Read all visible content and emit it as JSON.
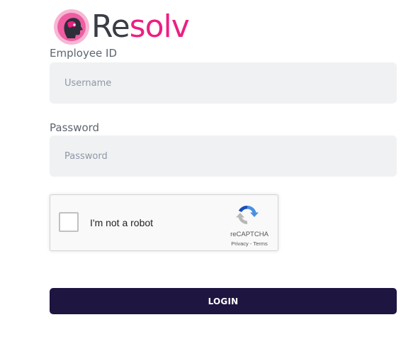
{
  "brand": {
    "name_prefix": "Re",
    "name_accent": "solv",
    "accent_color": "#ec1f82",
    "logo_icon": "head-silhouette-icon"
  },
  "form": {
    "employee_label": "Employee ID",
    "username_placeholder": "Username",
    "username_value": "",
    "password_label": "Password",
    "password_placeholder": "Password",
    "password_value": "",
    "login_label": "LOGIN",
    "login_color": "#1e1541"
  },
  "captcha": {
    "label": "I'm not a robot",
    "checked": false,
    "brand": "reCAPTCHA",
    "privacy": "Privacy",
    "separator": " - ",
    "terms": "Terms",
    "icon": "recaptcha-icon"
  }
}
